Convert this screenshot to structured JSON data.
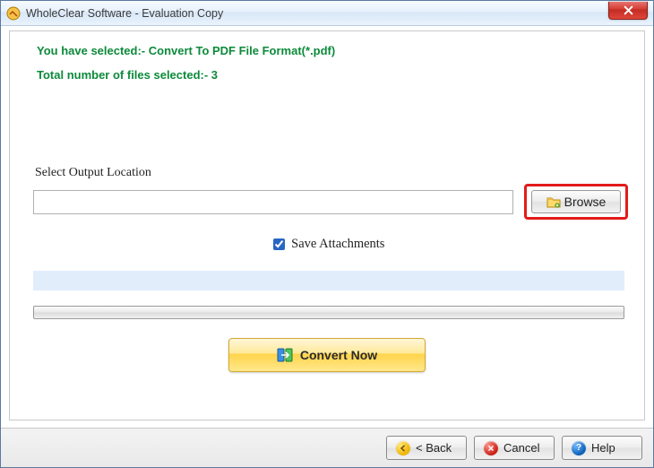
{
  "window": {
    "title": "WholeClear Software - Evaluation Copy"
  },
  "status": {
    "selected_format": "You have selected:- Convert To PDF File Format(*.pdf)",
    "file_count": "Total number of files selected:- 3"
  },
  "output": {
    "label": "Select Output Location",
    "path_value": "",
    "browse_label": "Browse"
  },
  "options": {
    "save_attachments_label": "Save Attachments",
    "save_attachments_checked": true
  },
  "actions": {
    "convert_label": "Convert Now"
  },
  "footer": {
    "back_label": "< Back",
    "cancel_label": "Cancel",
    "help_label": "Help"
  }
}
